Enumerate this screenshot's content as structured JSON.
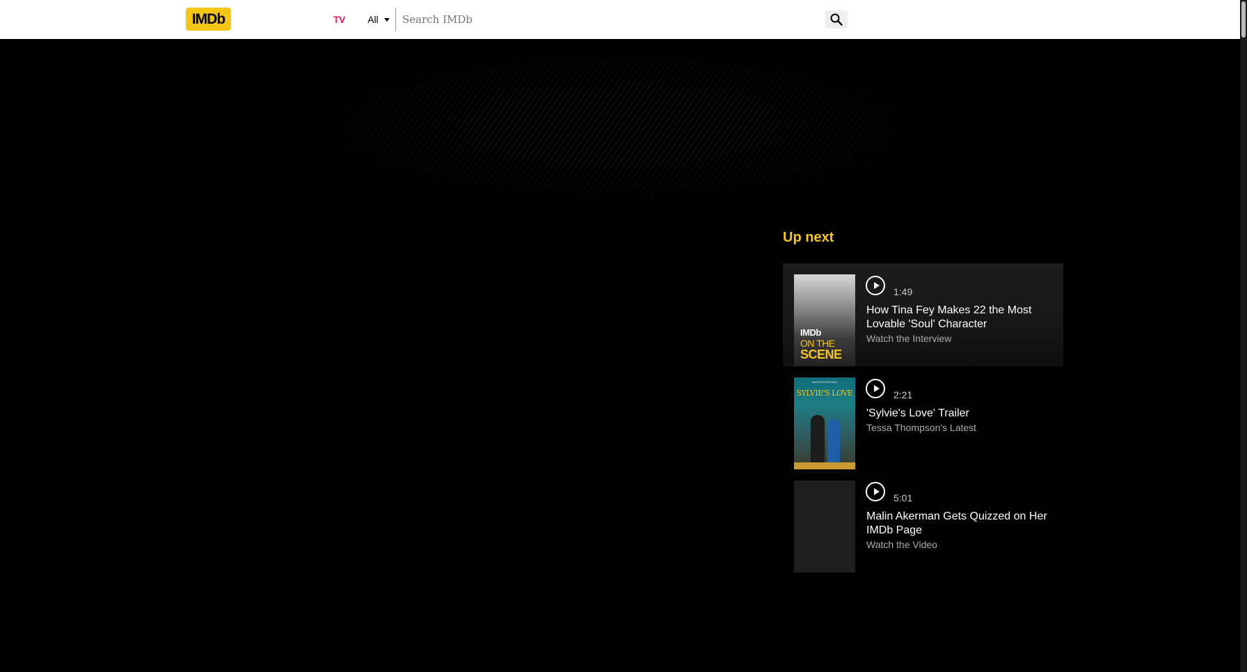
{
  "header": {
    "logo_text": "IMDb",
    "tv_label": "TV",
    "search": {
      "category": "All",
      "placeholder": "Search IMDb"
    }
  },
  "colors": {
    "brand_yellow": "#f5c518",
    "tv_accent": "#e91e63",
    "background": "#000000"
  },
  "up_next": {
    "title": "Up next",
    "items": [
      {
        "duration": "1:49",
        "title": "How Tina Fey Makes 22 the Most Lovable 'Soul' Character",
        "subtitle": "Watch the Interview",
        "thumb": {
          "imdb": "IMDb",
          "on_the": "ON THE",
          "scene": "SCENE"
        }
      },
      {
        "duration": "2:21",
        "title": "'Sylvie's Love' Trailer",
        "subtitle": "Tessa Thompson's Latest",
        "thumb": {
          "top_text": "AMAZON ORIGINAL",
          "title": "SYLVIE'S LOVE"
        }
      },
      {
        "duration": "5:01",
        "title": "Malin Akerman Gets Quizzed on Her IMDb Page",
        "subtitle": "Watch the Video"
      }
    ]
  }
}
